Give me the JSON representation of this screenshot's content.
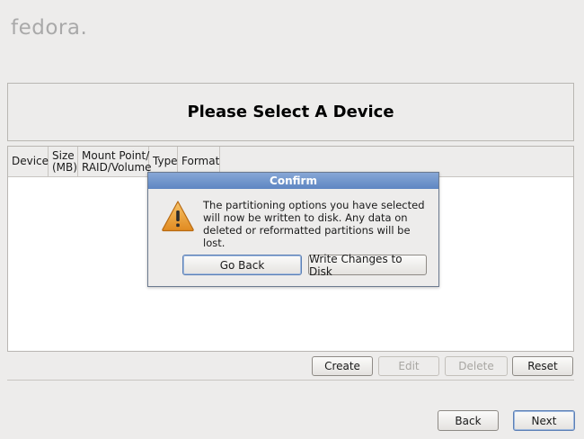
{
  "branding": {
    "logo_text": "fedora",
    "logo_dot": "."
  },
  "page": {
    "title": "Please Select A Device"
  },
  "table": {
    "columns": [
      "Device",
      "Size\n(MB)",
      "Mount Point/\nRAID/Volume",
      "Type",
      "Format"
    ]
  },
  "actions": {
    "create_label": "Create",
    "edit_label": "Edit",
    "delete_label": "Delete",
    "reset_label": "Reset"
  },
  "nav": {
    "back_label": "Back",
    "next_label": "Next"
  },
  "dialog": {
    "title": "Confirm",
    "icon": "warning-icon",
    "message": "The partitioning options you have selected will now be written to disk.  Any data on deleted or reformatted partitions will be lost.",
    "go_back_label": "Go Back",
    "write_label": "Write Changes to Disk"
  },
  "colors": {
    "background": "#edeceb",
    "dialog_title": "#6f93c8",
    "warning_fill": "#f0a33a"
  }
}
